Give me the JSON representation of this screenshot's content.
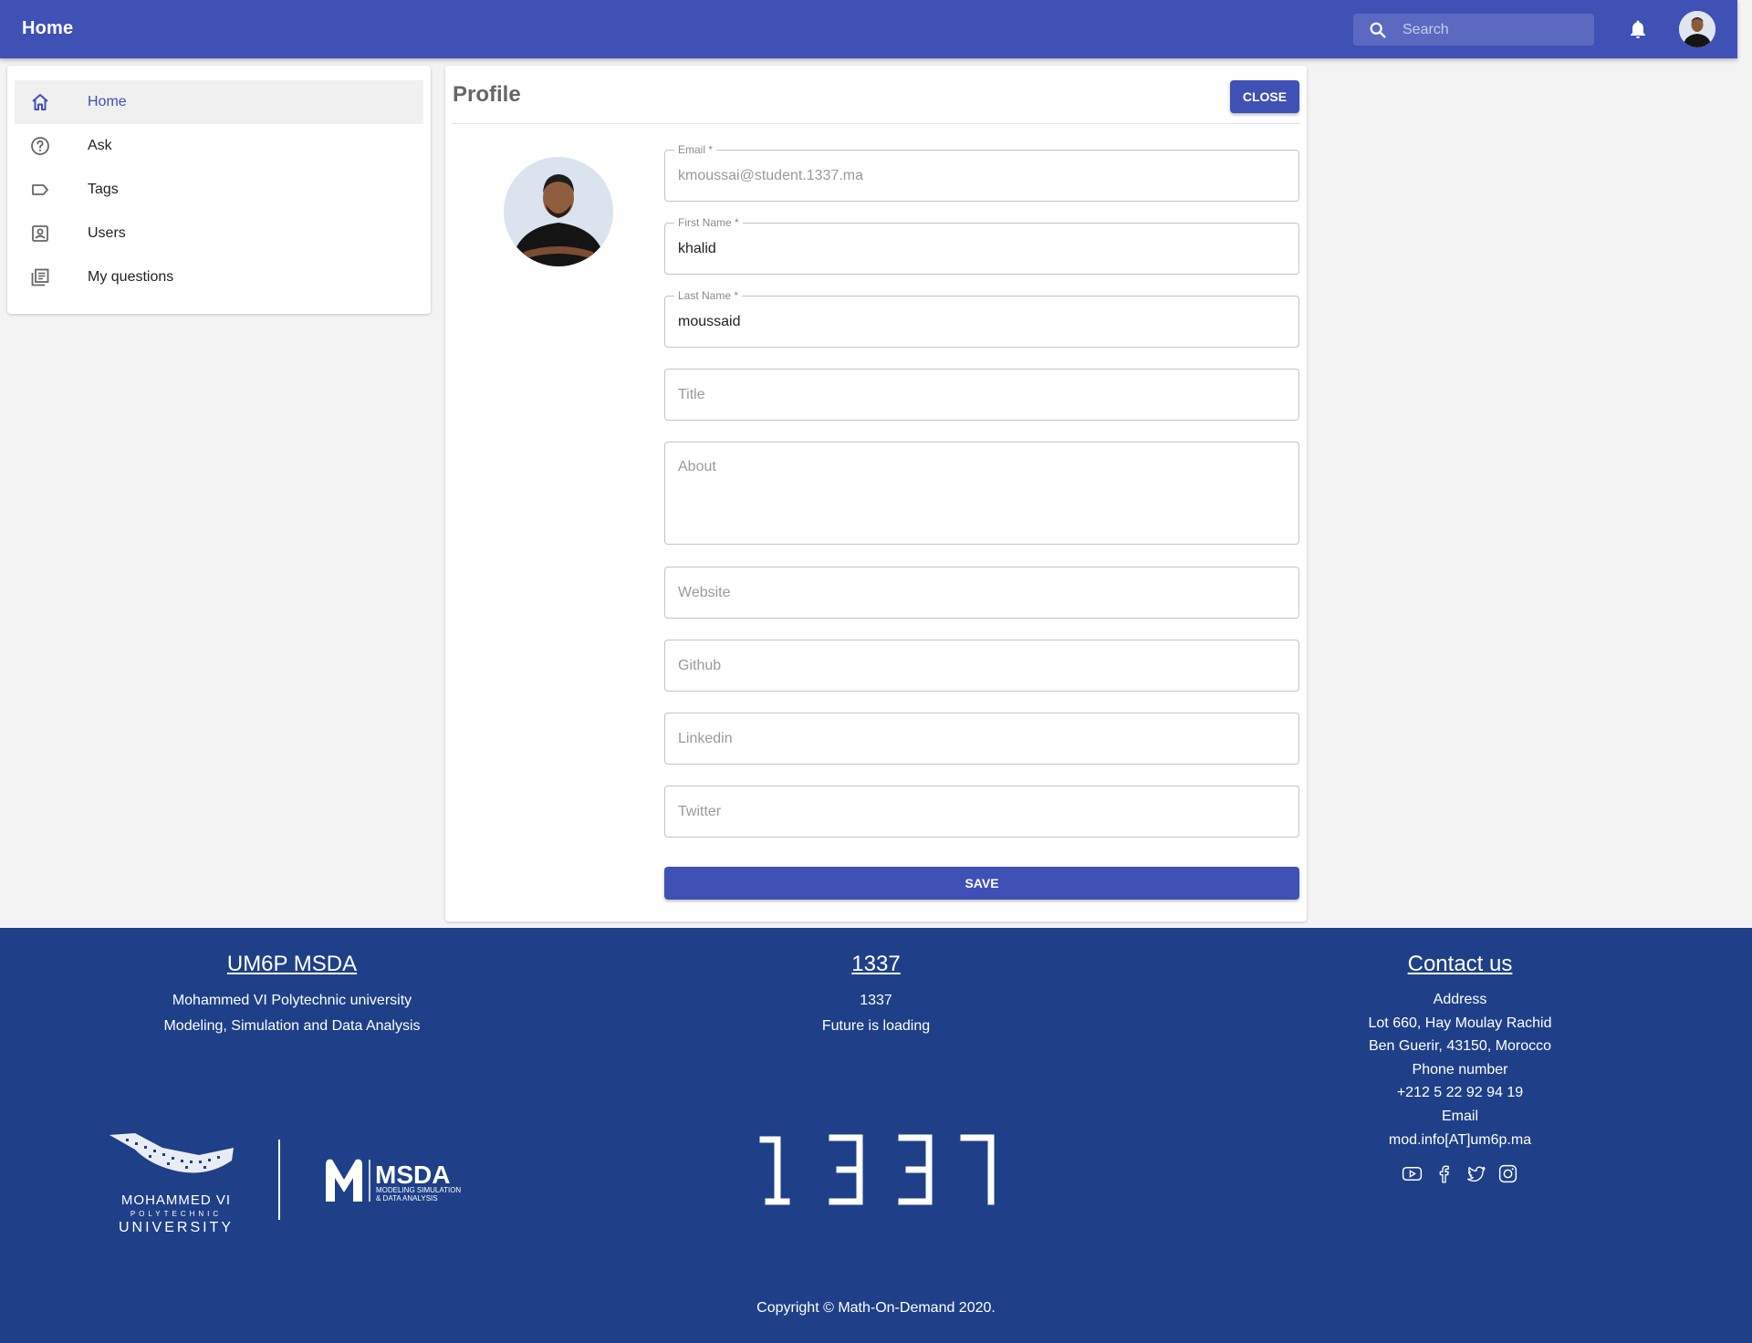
{
  "appbar": {
    "title": "Home",
    "search_placeholder": "Search",
    "color": "#3f51b5"
  },
  "sidebar": {
    "items": [
      {
        "label": "Home",
        "icon": "home-icon",
        "active": true
      },
      {
        "label": "Ask",
        "icon": "help-circle-icon",
        "active": false
      },
      {
        "label": "Tags",
        "icon": "label-icon",
        "active": false
      },
      {
        "label": "Users",
        "icon": "account-box-icon",
        "active": false
      },
      {
        "label": "My questions",
        "icon": "library-books-icon",
        "active": false
      }
    ]
  },
  "profile": {
    "title": "Profile",
    "close_label": "CLOSE",
    "save_label": "SAVE",
    "fields": {
      "email": {
        "label": "Email *",
        "value": "kmoussai@student.1337.ma"
      },
      "first_name": {
        "label": "First Name *",
        "value": "khalid"
      },
      "last_name": {
        "label": "Last Name *",
        "value": "moussaid"
      },
      "title": {
        "placeholder": "Title"
      },
      "about": {
        "placeholder": "About"
      },
      "website": {
        "placeholder": "Website"
      },
      "github": {
        "placeholder": "Github"
      },
      "linkedin": {
        "placeholder": "Linkedin"
      },
      "twitter": {
        "placeholder": "Twitter"
      }
    }
  },
  "footer": {
    "background": "#1f4088",
    "col1": {
      "heading": "UM6P MSDA",
      "line1": "Mohammed VI Polytechnic university",
      "line2": "Modeling, Simulation and Data Analysis"
    },
    "col2": {
      "heading": "1337",
      "line1": "1337",
      "line2": "Future is loading"
    },
    "col3": {
      "heading": "Contact us",
      "address_label": "Address",
      "address_line1": "Lot 660, Hay Moulay Rachid",
      "address_line2": "Ben Guerir, 43150, Morocco",
      "phone_label": "Phone number",
      "phone": "+212 5 22 92 94 19",
      "email_label": "Email",
      "email": "mod.info[AT]um6p.ma",
      "socials": [
        "youtube-icon",
        "facebook-icon",
        "twitter-icon",
        "instagram-icon"
      ]
    },
    "logos": {
      "um6p_line1": "MOHAMMED VI",
      "um6p_line2": "POLYTECHNIC",
      "um6p_line3": "UNIVERSITY",
      "msda_title": "MSDA",
      "msda_sub1": "MODELING SIMULATION",
      "msda_sub2": "& DATA ANALYSIS",
      "logo_1337": "1337"
    },
    "copyright": "Copyright © Math-On-Demand 2020."
  }
}
